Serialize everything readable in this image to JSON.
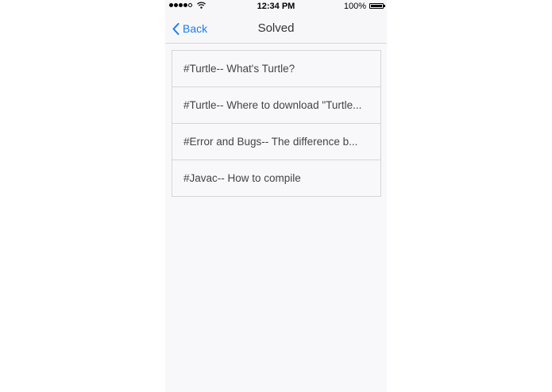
{
  "status_bar": {
    "signal_filled": 4,
    "signal_total": 5,
    "time": "12:34 PM",
    "battery_percent": "100%"
  },
  "nav": {
    "back_label": "Back",
    "title": "Solved"
  },
  "items": [
    {
      "label": "#Turtle-- What's Turtle?"
    },
    {
      "label": "#Turtle-- Where to download \"Turtle..."
    },
    {
      "label": "#Error and Bugs-- The difference b..."
    },
    {
      "label": "#Javac-- How to compile"
    }
  ],
  "colors": {
    "accent": "#1a7cf0",
    "background": "#f8f8fb",
    "divider": "#d4d4dc"
  }
}
